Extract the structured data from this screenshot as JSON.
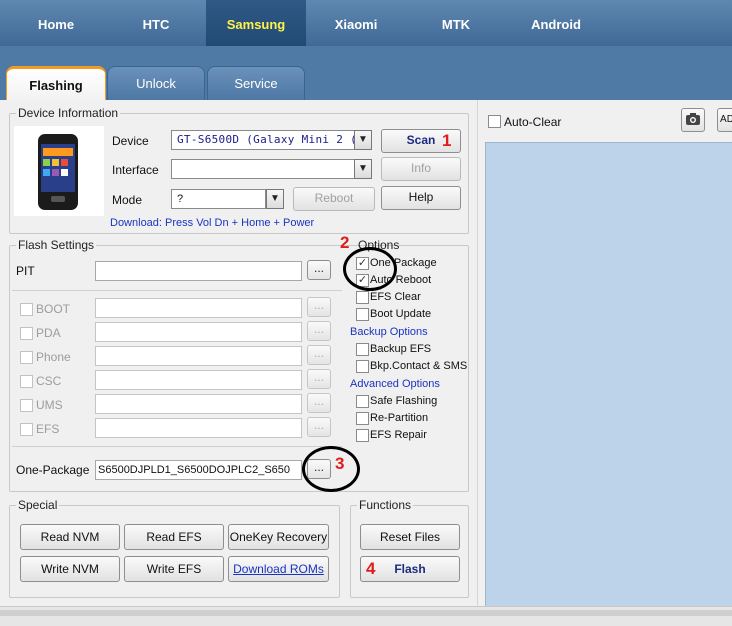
{
  "brand_tabs": [
    "Home",
    "HTC",
    "Samsung",
    "Xiaomi",
    "MTK",
    "Android"
  ],
  "sub_tabs": [
    "Flashing",
    "Unlock",
    "Service"
  ],
  "device_info": {
    "legend": "Device Information",
    "device_label": "Device",
    "device_value": "GT-S6500D (Galaxy Mini 2 (",
    "interface_label": "Interface",
    "interface_value": "",
    "mode_label": "Mode",
    "mode_value": "?",
    "scan_btn": "Scan",
    "info_btn": "Info",
    "reboot_btn": "Reboot",
    "help_btn": "Help",
    "download_hint": "Download: Press Vol Dn + Home + Power"
  },
  "flash_settings": {
    "legend": "Flash Settings",
    "pit_label": "PIT",
    "rows": [
      "BOOT",
      "PDA",
      "Phone",
      "CSC",
      "UMS",
      "EFS"
    ],
    "one_package_label": "One-Package",
    "one_package_value": "S6500DJPLD1_S6500DOJPLC2_S650"
  },
  "options": {
    "legend": "Options",
    "one_package": "One Package",
    "auto_reboot": "Auto Reboot",
    "efs_clear": "EFS Clear",
    "boot_update": "Boot Update",
    "backup_heading": "Backup Options",
    "backup_efs": "Backup EFS",
    "bkp_contact": "Bkp.Contact & SMS",
    "advanced_heading": "Advanced Options",
    "safe_flashing": "Safe Flashing",
    "re_partition": "Re-Partition",
    "efs_repair": "EFS Repair"
  },
  "special": {
    "legend": "Special",
    "read_nvm": "Read NVM",
    "read_efs": "Read EFS",
    "onekey_recovery": "OneKey Recovery",
    "write_nvm": "Write NVM",
    "write_efs": "Write EFS",
    "download_roms": "Download ROMs"
  },
  "functions": {
    "legend": "Functions",
    "reset_files": "Reset Files",
    "flash": "Flash"
  },
  "right_panel": {
    "auto_clear": "Auto-Clear",
    "ad_label": "AD"
  },
  "annotations": [
    "1",
    "2",
    "3",
    "4"
  ],
  "colors": {
    "brand_bar": "#4f7aa6",
    "active_brand_text": "#fff34a",
    "annotation": "#e01b1b",
    "preview_bg": "#bcd3ea",
    "link": "#1a34c0"
  },
  "icons": [
    "camera-icon",
    "dropdown-arrow-icon",
    "phone-image"
  ]
}
